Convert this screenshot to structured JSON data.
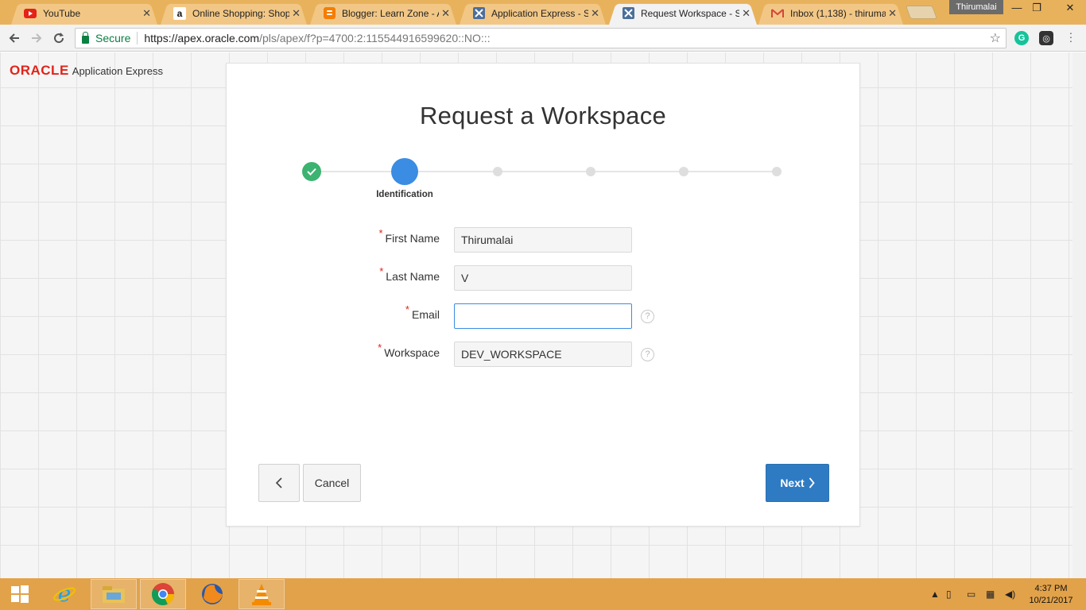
{
  "browser": {
    "tabs": [
      {
        "title": "YouTube",
        "icon": "youtube-icon",
        "active": false
      },
      {
        "title": "Online Shopping: Shop",
        "icon": "amazon-icon",
        "active": false
      },
      {
        "title": "Blogger: Learn Zone - A",
        "icon": "blogger-icon",
        "active": false
      },
      {
        "title": "Application Express - Si",
        "icon": "apex-icon",
        "active": false
      },
      {
        "title": "Request Workspace - Se",
        "icon": "apex-icon",
        "active": true
      },
      {
        "title": "Inbox (1,138) - thirumal",
        "icon": "gmail-icon",
        "active": false
      }
    ],
    "profile_name": "Thirumalai",
    "secure_label": "Secure",
    "url_host": "https://apex.oracle.com",
    "url_path": "/pls/apex/f?p=4700:2:115544916599620::NO:::"
  },
  "page": {
    "logo_brand": "ORACLE",
    "logo_product": "Application Express",
    "title": "Request a Workspace",
    "steps": {
      "count": 6,
      "current_index": 1,
      "current_label": "Identification"
    },
    "fields": [
      {
        "label": "First Name",
        "value": "Thirumalai",
        "required": true,
        "help": false
      },
      {
        "label": "Last Name",
        "value": "V",
        "required": true,
        "help": false
      },
      {
        "label": "Email",
        "value": "",
        "required": true,
        "help": true
      },
      {
        "label": "Workspace",
        "value": "DEV_WORKSPACE",
        "required": true,
        "help": true
      }
    ],
    "required_marker": "*",
    "help_glyph": "?",
    "buttons": {
      "back_glyph": "‹",
      "cancel": "Cancel",
      "next": "Next"
    }
  },
  "taskbar": {
    "time": "4:37 PM",
    "date": "10/21/2017"
  },
  "colors": {
    "oracle_red": "#e2231a",
    "primary_button": "#2f7bc3",
    "step_done": "#3cb371",
    "step_current": "#3b8ce3",
    "taskbar": "#e2a24a"
  }
}
